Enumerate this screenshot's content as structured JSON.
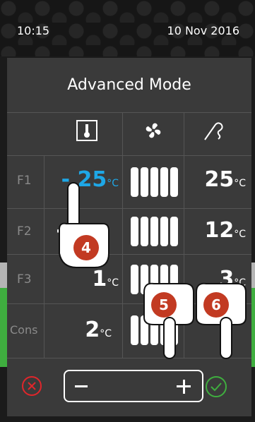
{
  "status": {
    "time": "10:15",
    "date": "10 Nov 2016"
  },
  "dialog": {
    "title": "Advanced Mode",
    "columns": [
      {
        "icon": "thermometer-icon"
      },
      {
        "icon": "fan-icon"
      },
      {
        "icon": "hook-icon"
      }
    ],
    "rows": [
      {
        "label": "F1",
        "temp": "- 25",
        "temp_unit": "°C",
        "fan_level": 5,
        "hook": "25",
        "hook_unit": "°C"
      },
      {
        "label": "F2",
        "temp": "-",
        "temp_unit": "",
        "fan_level": 5,
        "hook": "12",
        "hook_unit": "°C"
      },
      {
        "label": "F3",
        "temp": "1",
        "temp_unit": "°C",
        "fan_level": 5,
        "hook": "3",
        "hook_unit": "°C"
      },
      {
        "label": "Cons",
        "temp": "2",
        "temp_unit": "°C",
        "fan_level": 5,
        "hook": "",
        "hook_unit": ""
      }
    ],
    "cancel_icon": "x-circle-icon",
    "confirm_icon": "check-circle-icon",
    "stepper": {
      "minus_icon": "minus-icon",
      "plus_icon": "plus-icon"
    }
  },
  "callouts": [
    "4",
    "5",
    "6"
  ],
  "colors": {
    "accent_blue": "#1ea7e6",
    "cancel_red": "#e0262b",
    "confirm_green": "#3fae3f",
    "callout_red": "#c23a22"
  }
}
